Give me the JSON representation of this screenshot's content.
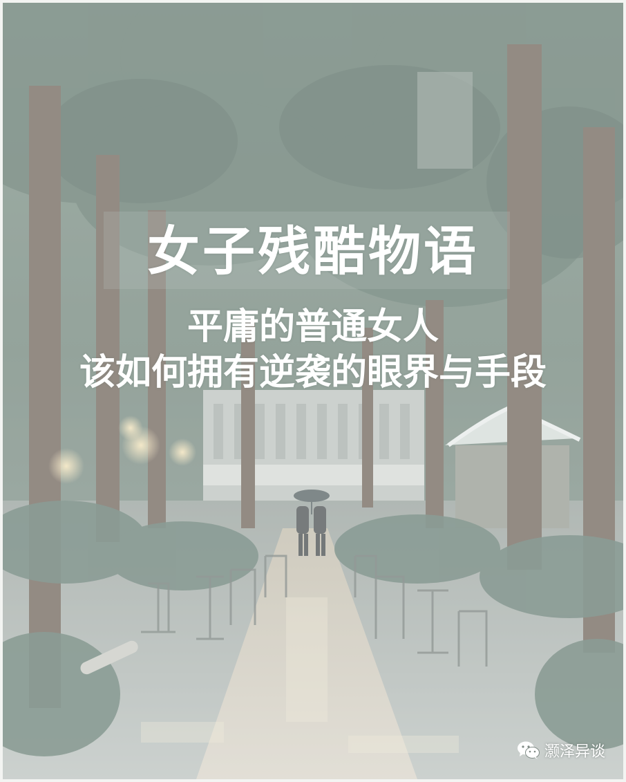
{
  "title": "女子残酷物语",
  "subtitle": {
    "line1": "平庸的普通女人",
    "line2": "该如何拥有逆袭的眼界与手段"
  },
  "watermark": {
    "icon": "wechat-icon",
    "text": "灏泽异谈"
  },
  "colors": {
    "text": "#ffffff",
    "foliage": "#4f6a5e",
    "canopy": "#3f5a50"
  }
}
